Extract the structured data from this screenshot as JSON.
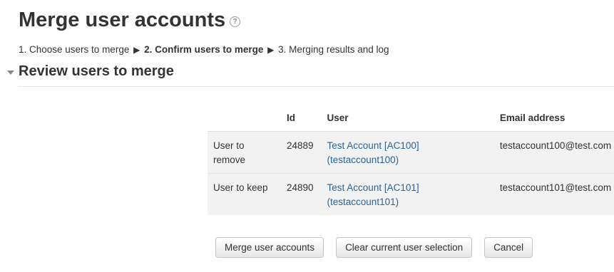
{
  "page": {
    "title": "Merge user accounts",
    "help_icon": "?"
  },
  "steps": {
    "step1": "1. Choose users to merge",
    "step2": "2. Confirm users to merge",
    "step3": "3. Merging results and log",
    "separator": "▶"
  },
  "section": {
    "title": "Review users to merge"
  },
  "table": {
    "headers": [
      "",
      "Id",
      "User",
      "Email address"
    ],
    "rows": [
      {
        "role_line1": "User to",
        "role_line2": "remove",
        "id": "24889",
        "user_line1": "Test Account [AC100]",
        "user_line2": "(testaccount100)",
        "email": "testaccount100@test.com"
      },
      {
        "role_line1": "User to keep",
        "role_line2": "",
        "id": "24890",
        "user_line1": "Test Account [AC101]",
        "user_line2": "(testaccount101)",
        "email": "testaccount101@test.com"
      }
    ]
  },
  "buttons": {
    "merge": "Merge user accounts",
    "clear": "Clear current user selection",
    "cancel": "Cancel"
  },
  "colors": {
    "link": "#2a6496",
    "row_bg": "#f2f2f2",
    "text": "#333333"
  },
  "icons": {
    "help": "help-icon",
    "collapse": "collapse-triangle-icon"
  }
}
